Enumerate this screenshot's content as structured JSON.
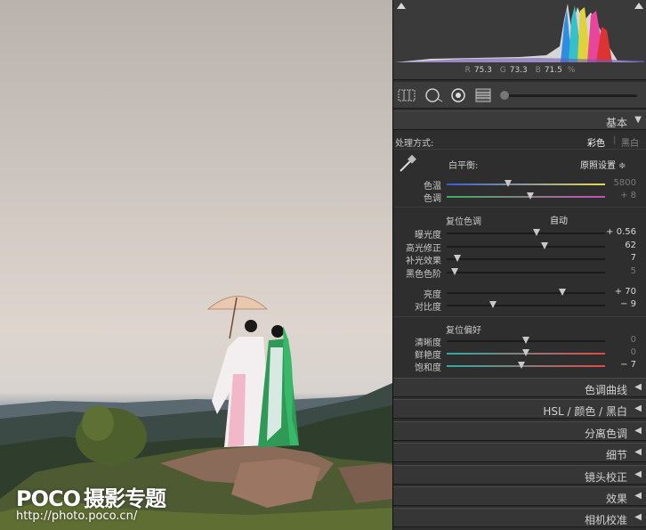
{
  "watermark": {
    "brand": "POCO",
    "brand_sub": "摄影专题",
    "url": "http://photo.poco.cn/"
  },
  "histogram": {
    "r_label": "R",
    "r_value": "75.3",
    "g_label": "G",
    "g_value": "73.3",
    "b_label": "B",
    "b_value": "71.5",
    "unit": "%"
  },
  "basic": {
    "header": "基本",
    "treatment_label": "处理方式:",
    "treatment_color": "彩色",
    "treatment_bw": "黑白",
    "wb_label": "白平衡:",
    "wb_value": "原照设置 ≑",
    "wb_sliders": [
      {
        "name": "色温",
        "value": "5800",
        "pos": 0.39,
        "dim": true
      },
      {
        "name": "色调",
        "value": "+ 8",
        "pos": 0.53,
        "dim": true
      }
    ],
    "tone_label": "复位色调",
    "auto_label": "自动",
    "tone_sliders": [
      {
        "name": "曝光度",
        "value": "+ 0.56",
        "pos": 0.57,
        "dim": false
      },
      {
        "name": "高光修正",
        "value": "62",
        "pos": 0.62,
        "dim": false
      },
      {
        "name": "补光效果",
        "value": "7",
        "pos": 0.07,
        "dim": false
      },
      {
        "name": "黑色色阶",
        "value": "5",
        "pos": 0.05,
        "dim": true
      }
    ],
    "bc_sliders": [
      {
        "name": "亮度",
        "value": "+ 70",
        "pos": 0.73,
        "dim": false
      },
      {
        "name": "对比度",
        "value": "− 9",
        "pos": 0.29,
        "dim": false
      }
    ],
    "presence_label": "复位偏好",
    "presence_sliders": [
      {
        "name": "清晰度",
        "value": "0",
        "pos": 0.5,
        "dim": true
      },
      {
        "name": "鲜艳度",
        "value": "0",
        "pos": 0.5,
        "dim": true
      },
      {
        "name": "饱和度",
        "value": "− 7",
        "pos": 0.47,
        "dim": false
      }
    ]
  },
  "sections": [
    {
      "label": "色调曲线"
    },
    {
      "label": "HSL  /  颜色  /  黑白"
    },
    {
      "label": "分离色调"
    },
    {
      "label": "细节"
    },
    {
      "label": "镜头校正"
    },
    {
      "label": "效果"
    },
    {
      "label": "相机校准"
    }
  ],
  "colors": {
    "panel_bg": "#2e2e2e",
    "header_bg": "#3b3b3b",
    "text": "#c8c8c8",
    "knob": "#c8c8c8"
  }
}
